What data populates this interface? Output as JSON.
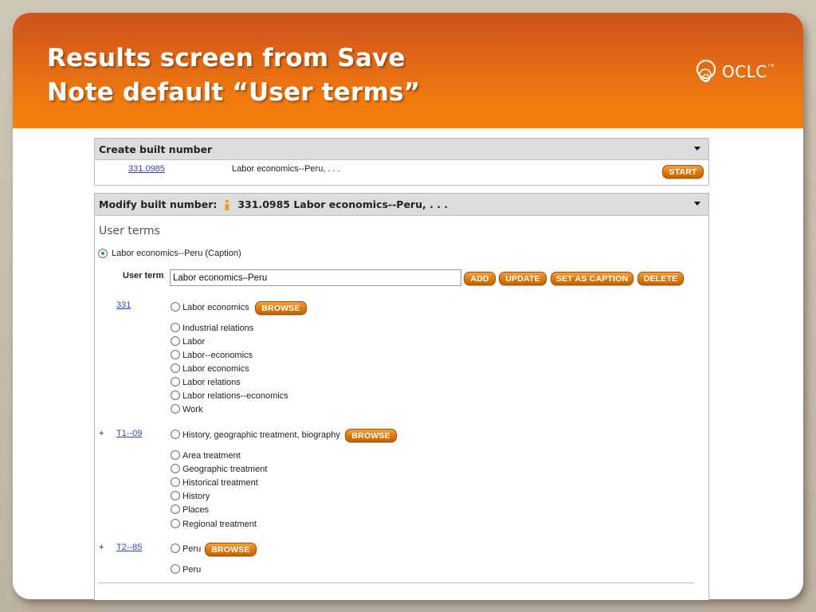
{
  "slide": {
    "title_lines": [
      "Results screen from Save",
      "Note default “User terms”"
    ],
    "logo": {
      "text": "OCLC",
      "tm": "TM",
      "icon": "oclc-logo-icon"
    }
  },
  "create_panel": {
    "header": "Create built number",
    "number": "331.0985",
    "caption": "Labor economics--Peru, . . .",
    "start_label": "START",
    "icon": "chevron-down-icon"
  },
  "modify_panel": {
    "header_label": "Modify built number:",
    "header_value": "331.0985 Labor economics--Peru, . . .",
    "info_icon": "info-icon",
    "section_title": "User terms",
    "selected_term": "Labor economics--Peru  (Caption)",
    "user_term_label": "User term",
    "user_term_value": "Labor economics–Peru",
    "buttons": {
      "add": "ADD",
      "update": "UPDATE",
      "set_caption": "SET AS CAPTION",
      "delete": "DELETE"
    },
    "groups": [
      {
        "prefix": "",
        "number": "331",
        "heading": "Labor economics",
        "browse_label": "BROWSE",
        "terms": [
          "Industrial relations",
          "Labor",
          "Labor--economics",
          "Labor economics",
          "Labor relations",
          "Labor relations--economics",
          "Work"
        ]
      },
      {
        "prefix": "+",
        "number": "T1--09",
        "heading": "History, geographic treatment, biography",
        "browse_label": "BROWSE",
        "terms": [
          "Area treatment",
          "Geographic treatment",
          "Historical treatment",
          "History",
          "Places",
          "Regional treatment"
        ]
      },
      {
        "prefix": "+",
        "number": "T2--85",
        "heading": "Peru",
        "browse_label": "BROWSE",
        "terms": [
          "Peru"
        ]
      }
    ]
  }
}
